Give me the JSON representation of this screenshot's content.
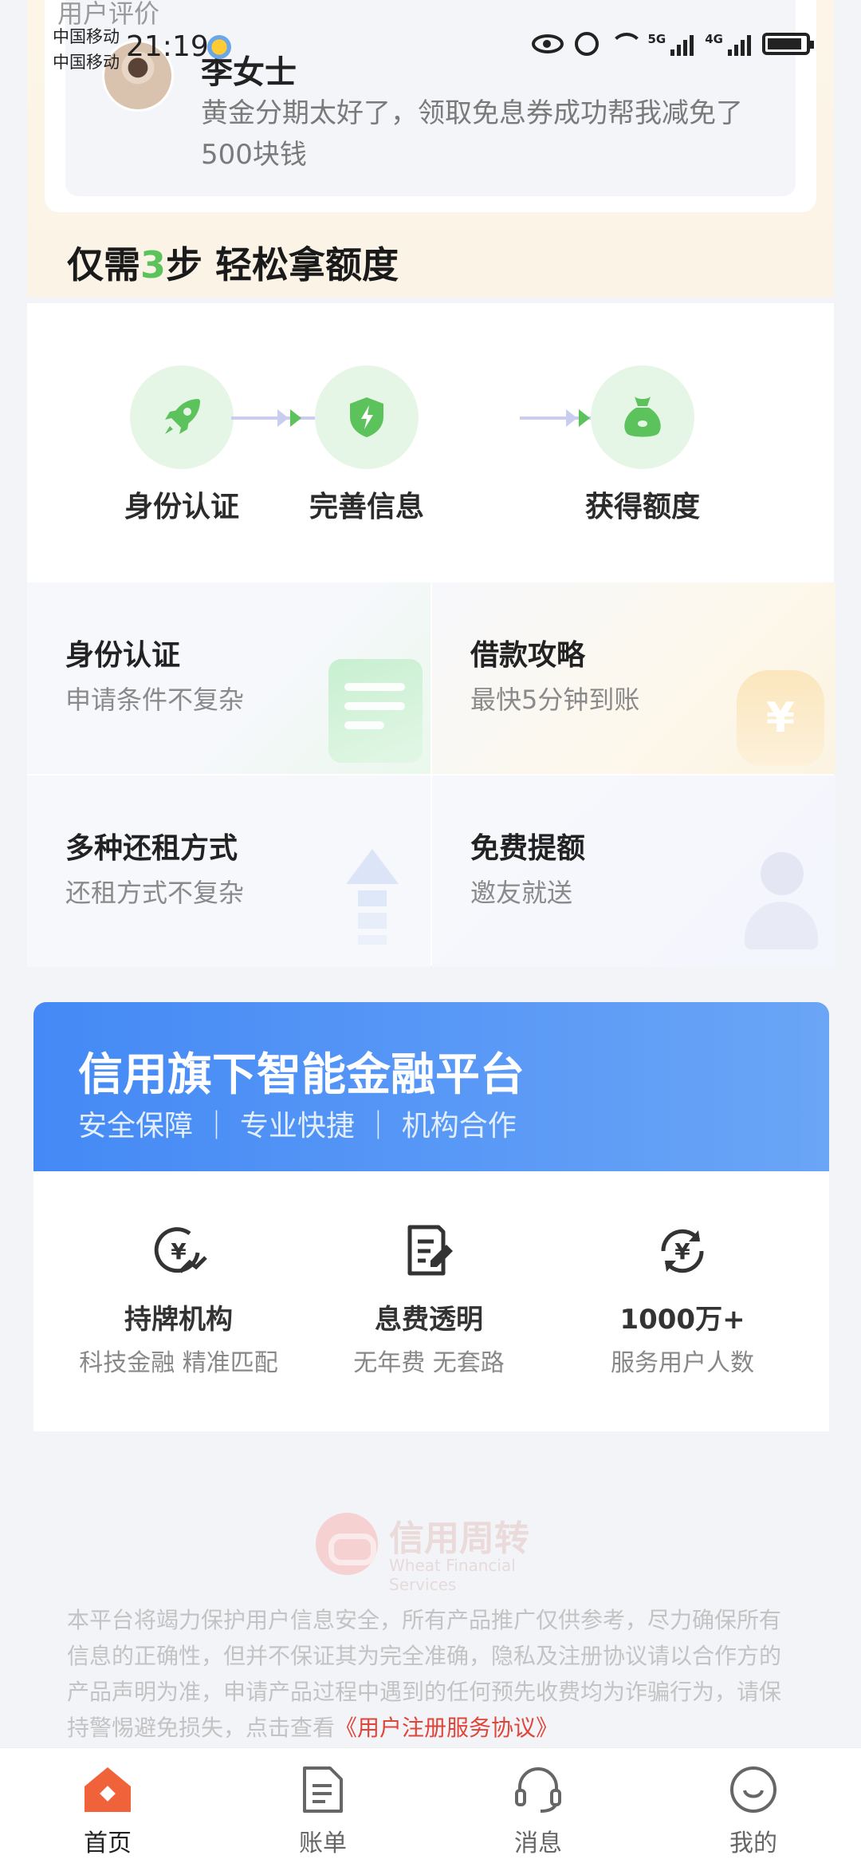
{
  "status_bar": {
    "carrier_1": "中国移动",
    "carrier_2": "中国移动",
    "time": "21:19",
    "net_tag_1": "5G",
    "net_tag_2": "4G"
  },
  "review": {
    "heading": "用户评价",
    "name": "李女士",
    "text": "黄金分期太好了，领取免息券成功帮我减免了500块钱"
  },
  "steps": {
    "title_prefix": "仅需",
    "title_number": "3",
    "title_suffix": "步 轻松拿额度",
    "items": [
      {
        "label": "身份认证",
        "icon": "rocket-icon"
      },
      {
        "label": "完善信息",
        "icon": "shield-icon"
      },
      {
        "label": "获得额度",
        "icon": "money-bag-icon"
      }
    ]
  },
  "features": [
    {
      "title": "身份认证",
      "subtitle": "申请条件不复杂"
    },
    {
      "title": "借款攻略",
      "subtitle": "最快5分钟到账"
    },
    {
      "title": "多种还租方式",
      "subtitle": "还租方式不复杂"
    },
    {
      "title": "免费提额",
      "subtitle": "邀友就送"
    }
  ],
  "banner": {
    "title": "信用旗下智能金融平台",
    "subtitle": "安全保障 ｜ 专业快捷 ｜ 机构合作"
  },
  "stats": [
    {
      "title": "持牌机构",
      "subtitle": "科技金融 精准匹配",
      "icon": "yen-coin-icon"
    },
    {
      "title": "息费透明",
      "subtitle": "无年费 无套路",
      "icon": "document-edit-icon"
    },
    {
      "title": "1000万+",
      "subtitle": "服务用户人数",
      "icon": "yen-refresh-icon"
    }
  ],
  "footer": {
    "brand_name": "信用周转",
    "brand_en": "Wheat Financial Services",
    "disclaimer": "本平台将竭力保护用户信息安全，所有产品推广仅供参考，尽力确保所有信息的正确性，但并不保证其为完全准确，隐私及注册协议请以合作方的产品声明为准，申请产品过程中遇到的任何预先收费均为诈骗行为，请保持警惕避免损失，点击查看",
    "agreement_link": "《用户注册服务协议》"
  },
  "nav": {
    "items": [
      {
        "label": "首页",
        "icon": "home-icon",
        "active": true
      },
      {
        "label": "账单",
        "icon": "bill-icon",
        "active": false
      },
      {
        "label": "消息",
        "icon": "headset-icon",
        "active": false
      },
      {
        "label": "我的",
        "icon": "smile-icon",
        "active": false
      }
    ]
  },
  "colors": {
    "accent_green": "#5cc35c",
    "accent_blue": "#4489f5",
    "home_orange": "#f0623a",
    "link_red": "#e0453a"
  }
}
